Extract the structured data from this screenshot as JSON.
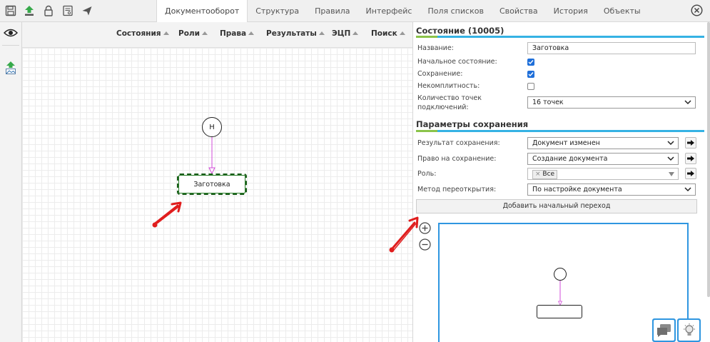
{
  "colors": {
    "accent_blue": "#35b2e4",
    "accent_green": "#8bc34a",
    "annotation_red": "#e01d1d",
    "node_border": "#1a5e1a",
    "connector": "#d24bd8"
  },
  "toolbar": {
    "icons": [
      "save-icon",
      "upload-icon",
      "lock-icon",
      "document-icon",
      "send-icon"
    ]
  },
  "tabs": [
    {
      "label": "Документооборот",
      "active": true
    },
    {
      "label": "Структура"
    },
    {
      "label": "Правила"
    },
    {
      "label": "Интерфейс"
    },
    {
      "label": "Поля списков"
    },
    {
      "label": "Свойства"
    },
    {
      "label": "История"
    },
    {
      "label": "Объекты"
    }
  ],
  "canvas_header": {
    "items": [
      "Состояния",
      "Роли",
      "Права",
      "Результаты",
      "ЭЦП",
      "Поиск"
    ]
  },
  "diagram": {
    "start_label": "Н",
    "state_label": "Заготовка"
  },
  "state_panel": {
    "title": "Состояние (10005)",
    "fields": {
      "name_label": "Название:",
      "name_value": "Заготовка",
      "initial_label": "Начальное состояние:",
      "initial_checked": true,
      "save_label": "Сохранение:",
      "save_checked": true,
      "incomplete_label": "Некомплитность:",
      "incomplete_checked": false,
      "points_label_1": "Количество точек",
      "points_label_2": "подключений:",
      "points_value": "16 точек"
    }
  },
  "save_params": {
    "title": "Параметры сохранения",
    "result_label": "Результат сохранения:",
    "result_value": "Документ изменен",
    "right_label": "Право на сохранение:",
    "right_value": "Создание документа",
    "role_label": "Роль:",
    "role_tag": "Все",
    "reopen_label": "Метод переоткрытия:",
    "reopen_value": "По настройке документа",
    "add_button": "Добавить начальный переход"
  }
}
